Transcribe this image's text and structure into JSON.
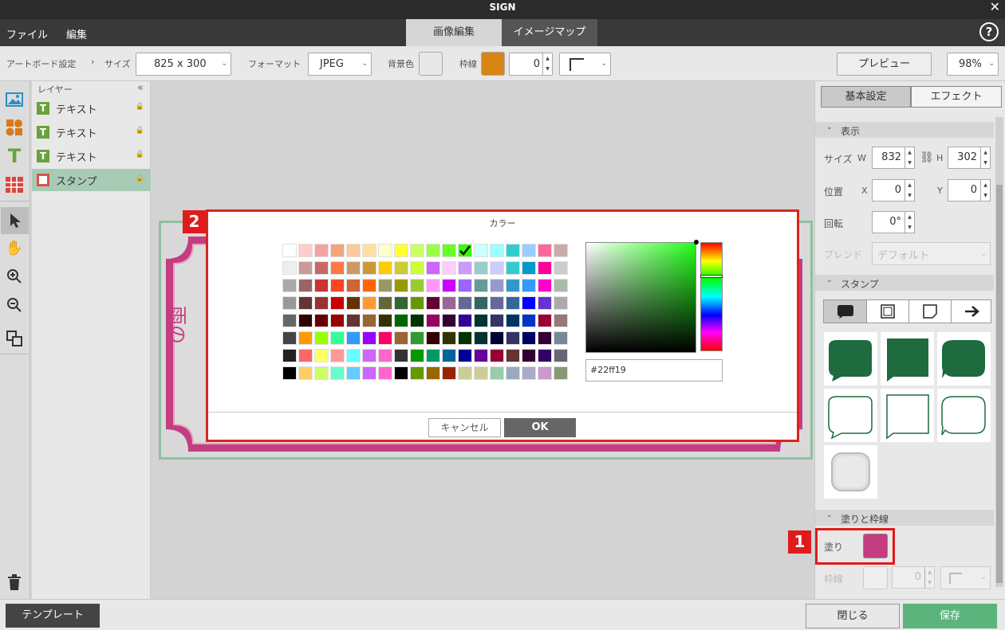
{
  "app": {
    "title": "SIGN",
    "close": "✕"
  },
  "menu": {
    "file": "ファイル",
    "edit": "編集",
    "tab_image": "画像編集",
    "tab_imagemap": "イメージマップ",
    "help": "?"
  },
  "toolbar": {
    "artboard": "アートボード設定",
    "sep": "›",
    "size_label": "サイズ",
    "size_value": "825 x 300",
    "format_label": "フォーマット",
    "format_value": "JPEG",
    "bg_label": "背景色",
    "border_label": "枠線",
    "border_color": "#d88514",
    "border_width": "0",
    "preview": "プレビュー",
    "zoom": "98%"
  },
  "layers": {
    "title": "レイヤー",
    "collapse": "«",
    "items": [
      {
        "type": "T",
        "label": "テキスト"
      },
      {
        "type": "T",
        "label": "テキスト"
      },
      {
        "type": "T",
        "label": "テキスト"
      },
      {
        "type": "S",
        "label": "スタンプ"
      }
    ]
  },
  "canvas": {
    "text": "雨の"
  },
  "right": {
    "tab_basic": "基本設定",
    "tab_effect": "エフェクト",
    "display": "表示",
    "size": "サイズ",
    "w": "W",
    "w_value": "832",
    "h": "H",
    "h_value": "302",
    "position": "位置",
    "x": "X",
    "x_value": "0",
    "y": "Y",
    "y_value": "0",
    "rotate": "回転",
    "rotate_value": "0°",
    "blend": "ブレンド",
    "blend_value": "デフォルト",
    "stamp": "スタンプ",
    "fill_stroke": "塗りと枠線",
    "fill": "塗り",
    "fill_color": "#c43d80",
    "stroke": "枠線",
    "stroke_width": "0"
  },
  "dialog": {
    "title": "カラー",
    "hex": "#22ff19",
    "cancel": "キャンセル",
    "ok": "OK",
    "swatches": [
      [
        "#ffffff",
        "#ffcccc",
        "#f4a3a3",
        "#f5a37b",
        "#fdc89a",
        "#fde0a0",
        "#ffffcc",
        "#ffff33",
        "#ccff66",
        "#99ff44",
        "#66ff22",
        "#33ff00",
        "#ccffff",
        "#99ffff",
        "#33cccc",
        "#99ccff",
        "#ff6699",
        "#ccaaaa"
      ],
      [
        "#eeeeee",
        "#cc9999",
        "#cc6666",
        "#ff7744",
        "#cc9966",
        "#cc9933",
        "#ffcc00",
        "#cccc33",
        "#ccff33",
        "#cc66ff",
        "#ffccff",
        "#cc99ff",
        "#99cccc",
        "#ccccff",
        "#33cccc",
        "#0099cc",
        "#ff0099",
        "#cccccc"
      ],
      [
        "#aaaaaa",
        "#996666",
        "#cc3333",
        "#ff4422",
        "#cc6633",
        "#ff6600",
        "#999966",
        "#999900",
        "#99cc33",
        "#ff99ff",
        "#cc00ff",
        "#9966ff",
        "#669999",
        "#9999cc",
        "#3399cc",
        "#3399ff",
        "#ff00cc",
        "#aabbaa"
      ],
      [
        "#999999",
        "#663333",
        "#993333",
        "#cc0000",
        "#663300",
        "#ff9933",
        "#666633",
        "#336633",
        "#669900",
        "#660033",
        "#996699",
        "#666699",
        "#336666",
        "#666699",
        "#336699",
        "#0000ff",
        "#6633cc",
        "#aaaaaa"
      ],
      [
        "#666666",
        "#330000",
        "#660000",
        "#990000",
        "#663333",
        "#996633",
        "#333300",
        "#006600",
        "#003300",
        "#990066",
        "#330033",
        "#330099",
        "#003333",
        "#333366",
        "#003366",
        "#0033cc",
        "#990033",
        "#997777"
      ],
      [
        "#444444",
        "#ff9900",
        "#99ff00",
        "#33ff99",
        "#3399ff",
        "#9900ff",
        "#ff0066",
        "#996633",
        "#339933",
        "#330000",
        "#333300",
        "#003300",
        "#003333",
        "#000033",
        "#333366",
        "#000066",
        "#330033",
        "#778899"
      ],
      [
        "#222222",
        "#ff6666",
        "#ffff66",
        "#ff9999",
        "#66ffff",
        "#cc66ff",
        "#ff66cc",
        "#333333",
        "#009900",
        "#009966",
        "#006699",
        "#000099",
        "#660099",
        "#990033",
        "#663333",
        "#330033",
        "#330066",
        "#666677"
      ],
      [
        "#000000",
        "#ffcc66",
        "#ccff66",
        "#66ffcc",
        "#66ccff",
        "#cc66ff",
        "#ff66cc",
        "#000000",
        "#669900",
        "#996600",
        "#992200",
        "#cccc99",
        "#cccc99",
        "#99ccaa",
        "#99aabb",
        "#aaaacc",
        "#cc99cc",
        "#889977"
      ]
    ]
  },
  "footer": {
    "template": "テンプレート",
    "close": "閉じる",
    "save": "保存"
  },
  "badges": {
    "one": "1",
    "two": "2"
  }
}
